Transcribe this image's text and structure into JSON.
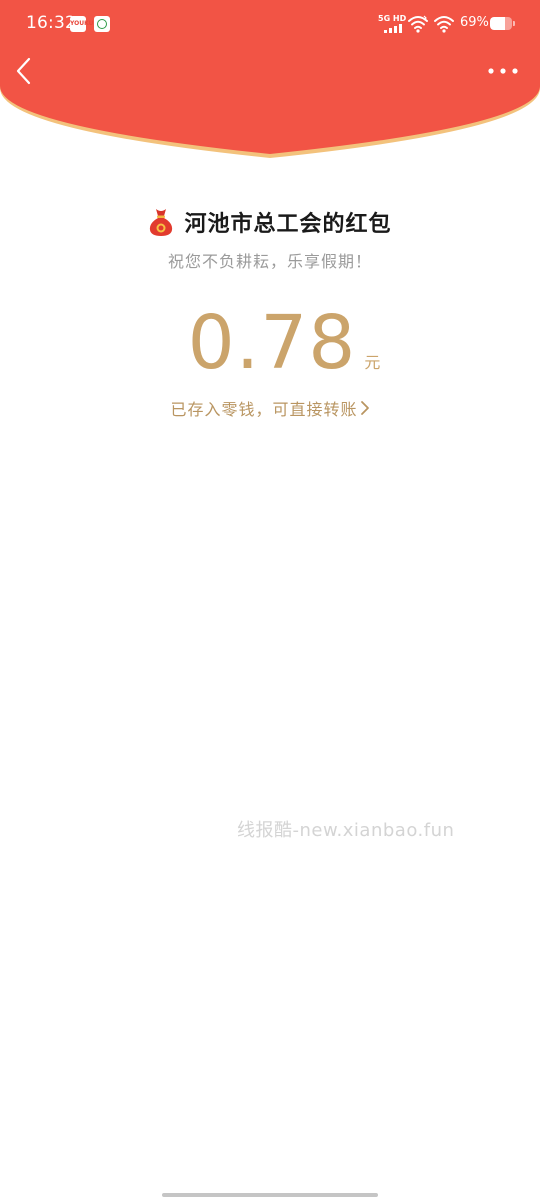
{
  "status_bar": {
    "time": "16:32",
    "app_icon_1_text": "YOUKU",
    "network_label": "5G HD",
    "battery_percent": "69%",
    "battery_level": 0.69
  },
  "colors": {
    "header_red": "#f25445",
    "header_border": "#f3c27c",
    "gold": "#cba46b",
    "link_gold": "#b99561"
  },
  "nav": {
    "back_icon": "chevron-left-icon",
    "more_icon": "more-dots-icon"
  },
  "red_packet": {
    "sender_title": "河池市总工会的红包",
    "greeting": "祝您不负耕耘，乐享假期！",
    "amount": "0.78",
    "unit": "元",
    "note": "已存入零钱，可直接转账"
  },
  "watermark": "线报酷-new.xianbao.fun"
}
